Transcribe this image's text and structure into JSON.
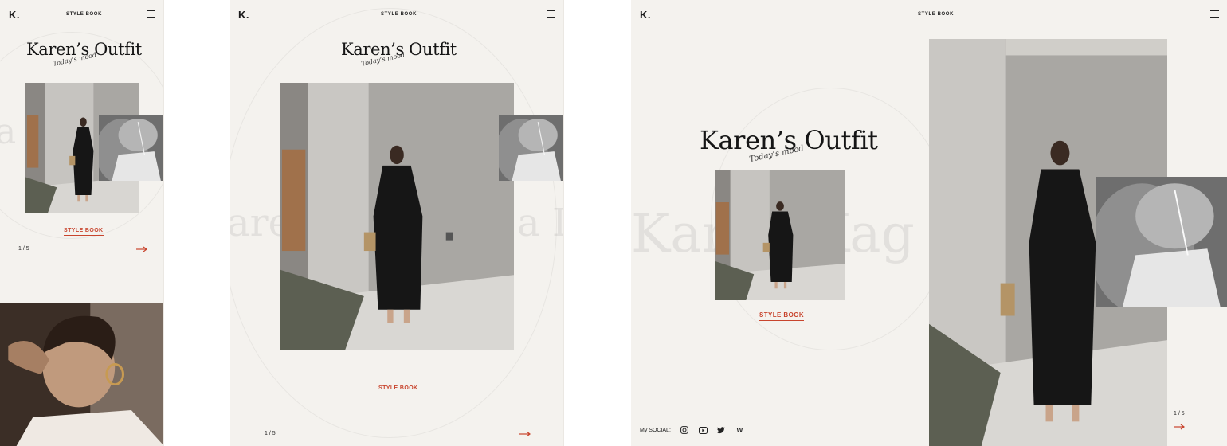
{
  "brand": {
    "logo": "K.",
    "nav_title": "STYLE BOOK"
  },
  "hero": {
    "title": "Karen’s Outfit",
    "subtitle": "Today’s mood"
  },
  "cta": {
    "label": "STYLE BOOK"
  },
  "pager": {
    "text": "1 / 5"
  },
  "ghost_text": {
    "mobile": "a  I",
    "tablet_left": "are",
    "tablet_right": "a I",
    "desktop_left": "Kar",
    "desktop_right": "Kag"
  },
  "social": {
    "label": "My SOCIAL:",
    "icons": [
      "instagram-icon",
      "youtube-icon",
      "twitter-icon",
      "w-icon"
    ],
    "w_glyph": "W"
  },
  "colors": {
    "accent": "#c8442d",
    "background": "#f4f2ee",
    "text": "#1a1a1a"
  }
}
